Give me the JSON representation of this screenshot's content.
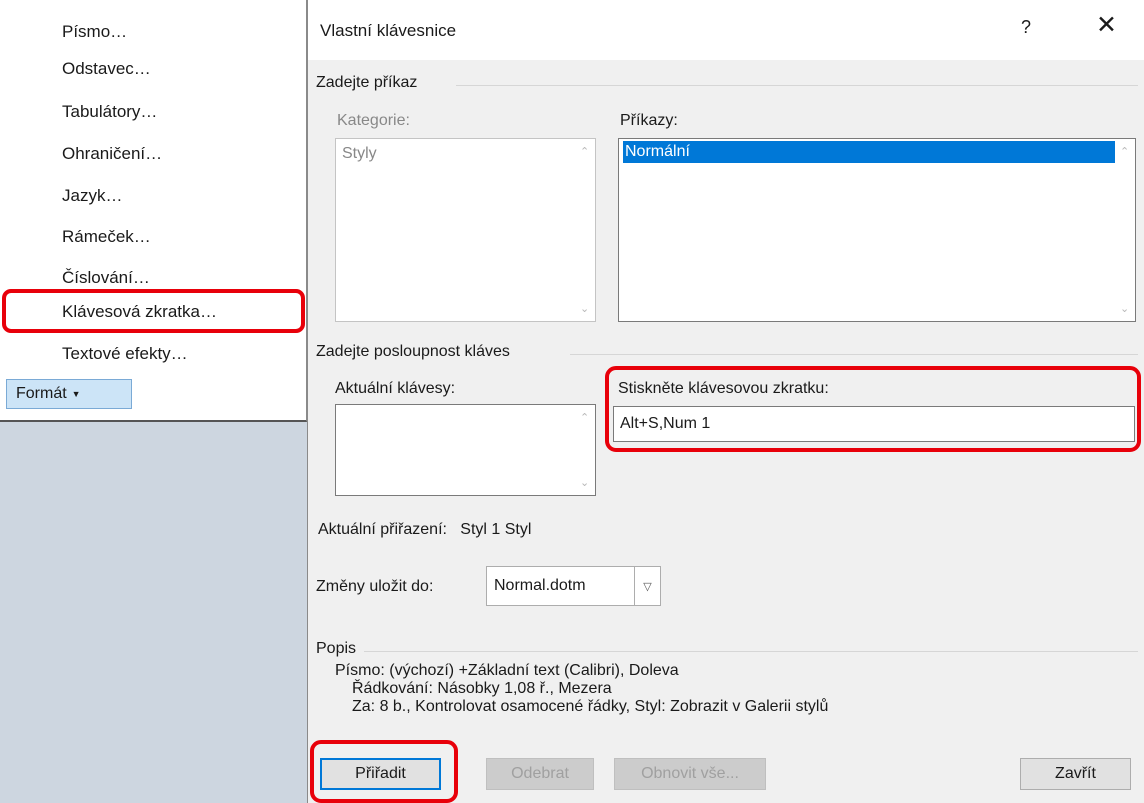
{
  "context_menu": {
    "items": [
      "Písmo…",
      "Odstavec…",
      "Tabulátory…",
      "Ohraničení…",
      "Jazyk…",
      "Rámeček…",
      "Číslování…",
      "Klávesová zkratka…",
      "Textové efekty…"
    ],
    "format_button": "Formát"
  },
  "dialog": {
    "title": "Vlastní klávesnice",
    "help": "?",
    "close": "✕",
    "command_group": "Zadejte příkaz",
    "categories_label": "Kategorie:",
    "categories_items": [
      "Styly"
    ],
    "commands_label": "Příkazy:",
    "commands_items": [
      "Normální"
    ],
    "keys_group": "Zadejte posloupnost kláves",
    "current_keys_label": "Aktuální klávesy:",
    "new_shortcut_label": "Stiskněte klávesovou zkratku:",
    "new_shortcut_value": "Alt+S,Num 1",
    "current_assignment_label": "Aktuální přiřazení:",
    "current_assignment_value": "Styl 1 Styl",
    "save_label": "Změny uložit do:",
    "save_value": "Normal.dotm",
    "description_group": "Popis",
    "description_lines": [
      "Písmo: (výchozí) +Základní text (Calibri), Doleva",
      "Řádkování:  Násobky 1,08 ř., Mezera",
      "Za:  8 b., Kontrolovat osamocené řádky, Styl: Zobrazit v Galerii stylů"
    ],
    "buttons": {
      "assign": "Přiřadit",
      "remove": "Odebrat",
      "reset_all": "Obnovit vše...",
      "close": "Zavřít"
    }
  },
  "colors": {
    "highlight": "#e8000a",
    "selection": "#0078d7",
    "dialog_body": "#f0f0f0",
    "sidebar_bg": "#cdd6e0"
  }
}
